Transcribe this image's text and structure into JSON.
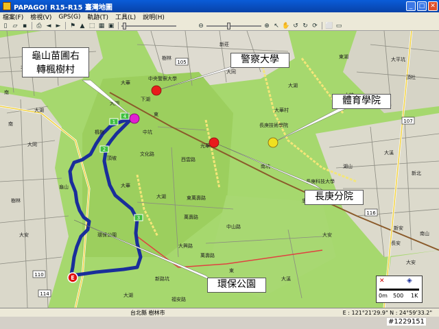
{
  "window": {
    "title": "PAPAGO! R15-R15 臺灣地圖"
  },
  "menu": {
    "items": [
      "檔案(F)",
      "檢視(V)",
      "GPS(G)",
      "軌跡(T)",
      "工具(L)",
      "說明(H)"
    ]
  },
  "toolbar": {
    "left_icons": [
      "new-icon",
      "open-icon",
      "save-icon",
      "print-icon",
      "back-icon",
      "forward-icon",
      "route-icon",
      "car-icon",
      "select-icon",
      "layers-icon",
      "photo-icon"
    ],
    "zoom_level": 0.4,
    "right_icons": [
      "zoom-in-icon",
      "pointer-icon",
      "pan-hand-icon",
      "rotate-left-icon",
      "rotate-right-icon",
      "refresh-icon",
      "measure-icon",
      "fit-window-icon"
    ]
  },
  "callouts": [
    {
      "id": "guishan",
      "lines": [
        "龜山苗圃右",
        "轉楓樹村"
      ]
    },
    {
      "id": "police",
      "lines": [
        "警察大學"
      ]
    },
    {
      "id": "sports",
      "lines": [
        "體育學院"
      ]
    },
    {
      "id": "changgung",
      "lines": [
        "長庚分院"
      ]
    },
    {
      "id": "eco",
      "lines": [
        "環保公園"
      ]
    }
  ],
  "map_labels": {
    "l1": "北",
    "l2": "南",
    "l3": "大湖",
    "l4": "中央警察大學",
    "l5": "下湖",
    "l6": "大華",
    "l7": "樹林",
    "l8": "大同",
    "l9": "大湖",
    "l10": "大華村",
    "l11": "長庚技術學院",
    "l12": "楓樹",
    "l13": "南",
    "l14": "光華",
    "l15": "文化路",
    "l16": "西雲路",
    "l17": "長庚科技大學",
    "l18": "大湖",
    "l19": "東萬壽路",
    "l20": "萬壽路",
    "l21": "大安",
    "l22": "大湖",
    "l23": "大同",
    "l24": "樹林",
    "l25": "環保公園",
    "l26": "大華",
    "l27": "龜山",
    "l28": "頂坡",
    "l29": "中山路",
    "l30": "大興路",
    "l31": "大湖",
    "l32": "新路坑",
    "l33": "福安路",
    "l34": "中坑",
    "l35": "東湖",
    "l36": "大坑",
    "l37": "大平坑",
    "l38": "頂社",
    "l39": "大溪",
    "l40": "湖山",
    "l41": "新北",
    "l42": "新安",
    "l43": "南山",
    "l44": "大溪",
    "l45": "大安",
    "l46": "新莊",
    "l47": "長安",
    "l48": "大安",
    "l49": "東",
    "l50": "東",
    "l51": "萬壽路",
    "l52": "忠孝",
    "l53": "南坑"
  },
  "road_shields": {
    "r105": "105",
    "r107": "107",
    "r110": "110",
    "r116": "116",
    "r114": "114"
  },
  "route_markers": {
    "m1": "1",
    "m2": "2",
    "m3": "3",
    "m4": "4",
    "start": "E"
  },
  "poi_colors": {
    "police": "#e81c1c",
    "changgung": "#e81c1c",
    "sports": "#f0e020",
    "guishan": "#e020d0"
  },
  "scale": {
    "zero": "0m",
    "mid": "500",
    "end": "1K"
  },
  "status": {
    "area": "台北縣 樹林市",
    "coords": "E : 121°21'29.9\"  N : 24°59'33.2\""
  },
  "watermark": "#1229151"
}
